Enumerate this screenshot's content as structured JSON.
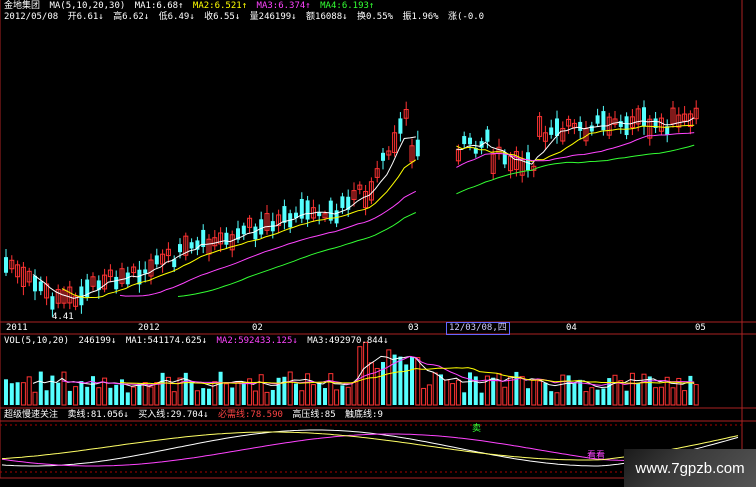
{
  "header": {
    "stock": "金地集团",
    "ma_label": "MA(5,10,20,30)",
    "ma1": "MA1:6.68↑",
    "ma2": "MA2:6.521↑",
    "ma3": "MA3:6.374↑",
    "ma4": "MA4:6.193↑"
  },
  "info": {
    "date": "2012/05/08",
    "open": "开6.61↓",
    "high": "高6.62↓",
    "low": "低6.49↓",
    "close": "收6.55↓",
    "volume": "量246199↓",
    "amount": "额16088↓",
    "turnover": "换0.55%",
    "amplitude": "振1.96%",
    "change": "涨(-0.0"
  },
  "price_low_label": "4.41",
  "xaxis": {
    "ticks": [
      "2011",
      "2012",
      "02",
      "03",
      "04",
      "05"
    ],
    "selected_date": "12/03/08,四"
  },
  "vol_panel": {
    "label": "VOL(5,10,20)",
    "value": "246199↓",
    "ma1": "MA1:541174.625↓",
    "ma2": "MA2:592433.125↓",
    "ma3": "MA3:492970.844↓"
  },
  "indicator_panel": {
    "name": "超级慢速关注",
    "sell_line": "卖线:81.056↓",
    "buy_line": "买入线:29.704↓",
    "must_sell": "必需线:78.590",
    "high_pressure": "高压线:85",
    "bottom_line": "触底线:9",
    "mark_sell": "卖",
    "mark_watch": "看看"
  },
  "watermark": "www.7gpzb.com",
  "colors": {
    "up": "#ff3333",
    "down": "#55ffff",
    "ma1": "#ffffff",
    "ma2": "#ffff00",
    "ma3": "#ff44ff",
    "ma4": "#33ff33"
  }
}
